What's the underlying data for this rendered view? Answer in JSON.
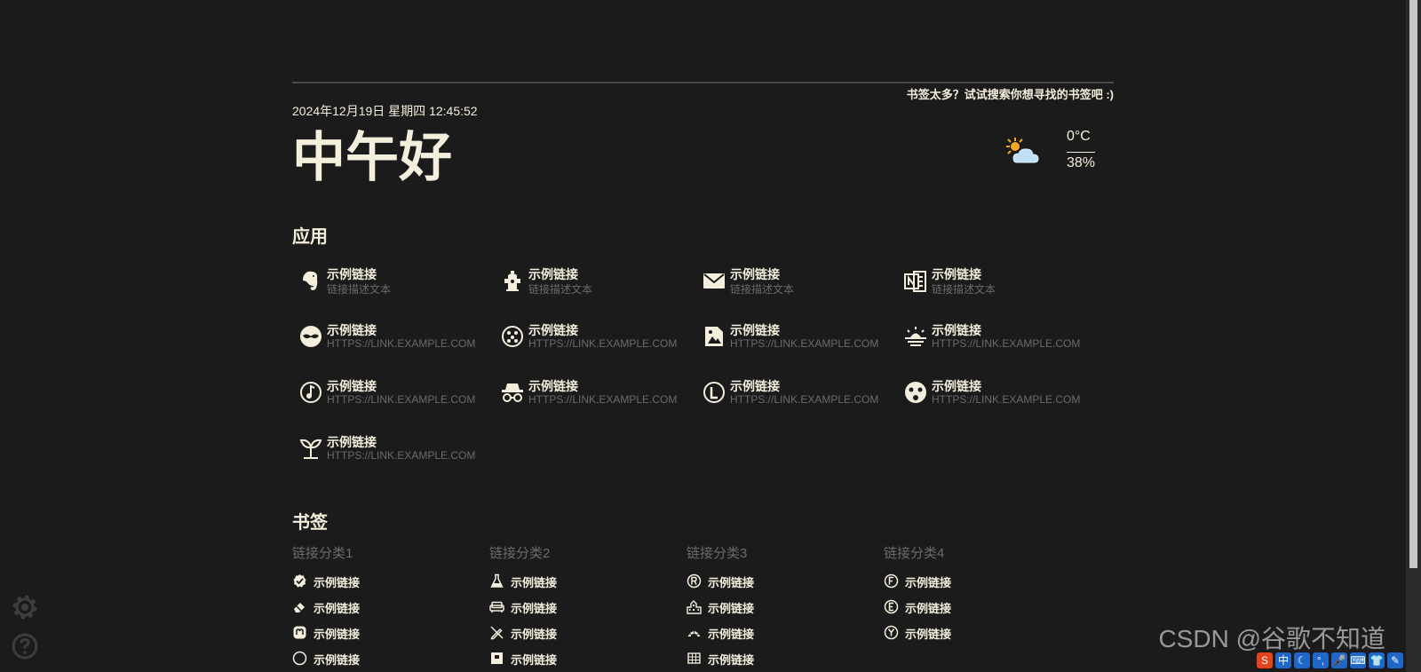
{
  "header": {
    "hint": "书签太多？试试搜索你想寻找的书签吧 :)",
    "datetime": "2024年12月19日 星期四 12:45:52",
    "greeting": "中午好"
  },
  "weather": {
    "icon": "partly-cloudy-icon",
    "temperature": "0°C",
    "humidity": "38%"
  },
  "apps": {
    "title": "应用",
    "items": [
      {
        "name": "示例链接",
        "desc": "链接描述文本",
        "icon": "evernote-icon"
      },
      {
        "name": "示例链接",
        "desc": "链接描述文本",
        "icon": "fire-hydrant-icon"
      },
      {
        "name": "示例链接",
        "desc": "链接描述文本",
        "icon": "email-icon"
      },
      {
        "name": "示例链接",
        "desc": "链接描述文本",
        "icon": "onenote-icon"
      },
      {
        "name": "示例链接",
        "desc": "HTTPS://LINK.EXAMPLE.COM",
        "icon": "mask-icon"
      },
      {
        "name": "示例链接",
        "desc": "HTTPS://LINK.EXAMPLE.COM",
        "icon": "dots-circle-icon"
      },
      {
        "name": "示例链接",
        "desc": "HTTPS://LINK.EXAMPLE.COM",
        "icon": "image-file-icon"
      },
      {
        "name": "示例链接",
        "desc": "HTTPS://LINK.EXAMPLE.COM",
        "icon": "sunset-icon"
      },
      {
        "name": "示例链接",
        "desc": "HTTPS://LINK.EXAMPLE.COM",
        "icon": "music-note-icon"
      },
      {
        "name": "示例链接",
        "desc": "HTTPS://LINK.EXAMPLE.COM",
        "icon": "incognito-icon"
      },
      {
        "name": "示例链接",
        "desc": "HTTPS://LINK.EXAMPLE.COM",
        "icon": "letter-l-circle-icon"
      },
      {
        "name": "示例链接",
        "desc": "HTTPS://LINK.EXAMPLE.COM",
        "icon": "face-icon"
      },
      {
        "name": "示例链接",
        "desc": "HTTPS://LINK.EXAMPLE.COM",
        "icon": "sprout-icon"
      }
    ]
  },
  "bookmarks": {
    "title": "书签",
    "categories": [
      {
        "name": "链接分类1",
        "items": [
          {
            "name": "示例链接",
            "icon": "check-badge-icon"
          },
          {
            "name": "示例链接",
            "icon": "eraser-icon"
          },
          {
            "name": "示例链接",
            "icon": "mastodon-icon"
          },
          {
            "name": "示例链接",
            "icon": "circle-icon"
          }
        ]
      },
      {
        "name": "链接分类2",
        "items": [
          {
            "name": "示例链接",
            "icon": "flask-icon"
          },
          {
            "name": "示例链接",
            "icon": "sofa-icon"
          },
          {
            "name": "示例链接",
            "icon": "no-pen-icon"
          },
          {
            "name": "示例链接",
            "icon": "box-icon"
          }
        ]
      },
      {
        "name": "链接分类3",
        "items": [
          {
            "name": "示例链接",
            "icon": "letter-r-circle-icon"
          },
          {
            "name": "示例链接",
            "icon": "city-icon"
          },
          {
            "name": "示例链接",
            "icon": "rainbow-icon"
          },
          {
            "name": "示例链接",
            "icon": "grid-icon"
          }
        ]
      },
      {
        "name": "链接分类4",
        "items": [
          {
            "name": "示例链接",
            "icon": "letter-f-circle-icon"
          },
          {
            "name": "示例链接",
            "icon": "letter-e-circle-icon"
          },
          {
            "name": "示例链接",
            "icon": "letter-y-circle-icon"
          }
        ]
      }
    ]
  },
  "sidebar": {
    "settings_icon": "gear-icon",
    "help_icon": "help-icon"
  },
  "overlay": {
    "watermark": "CSDN @谷歌不知道",
    "ime_label": "中"
  },
  "colors": {
    "background": "#1b1b1b",
    "text": "#f4eedc",
    "muted": "#6b6b6b"
  }
}
